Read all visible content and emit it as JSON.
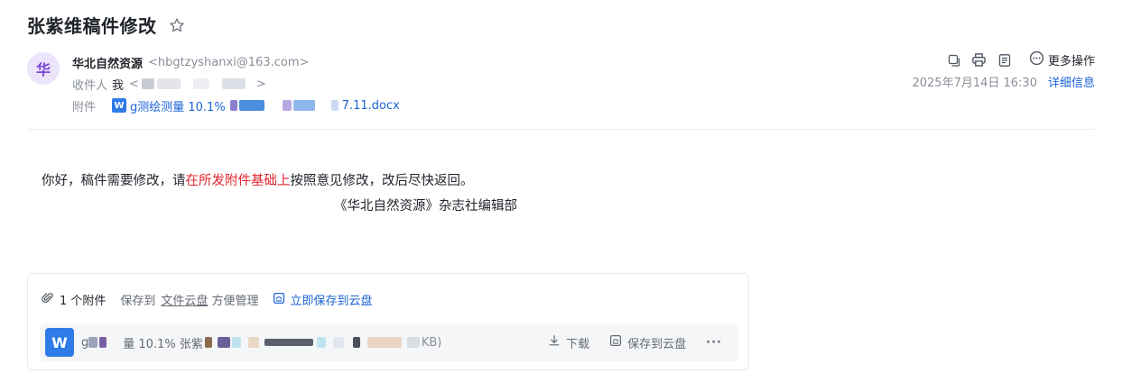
{
  "email": {
    "subject": "张紫维稿件修改",
    "avatar_char": "华",
    "sender_name": "华北自然资源",
    "sender_email": "<hbgtzyshanxi@163.com>",
    "recipient_label": "收件人",
    "recipient_me": "我",
    "recipient_open": "<",
    "recipient_close": ">",
    "attachment_label": "附件",
    "attachment_prefix": "g测绘测量 10.1%",
    "attachment_suffix": "7.11.docx",
    "date": "2025年7月14日 16:30",
    "detail_link": "详细信息",
    "more_ops": "更多操作"
  },
  "body": {
    "greeting": "你好，稿件需要修改，请",
    "highlight": "在所发附件基础上",
    "rest": "按照意见修改，改后尽快返回。",
    "signature": "《华北自然资源》杂志社编辑部"
  },
  "attachments": {
    "count_text": "1 个附件",
    "save_to": "保存到",
    "cloud_link": "文件云盘",
    "manage": "方便管理",
    "save_now": "立即保存到云盘",
    "file_icon_letter": "W",
    "file_prefix": "g",
    "file_mid": "量 10.1% 张紫",
    "file_size_tail": "KB)",
    "download": "下载",
    "save_to_cloud": "保存到云盘",
    "more": "···"
  },
  "icons": {
    "star": "star-icon",
    "copy": "copy-icon",
    "print": "print-icon",
    "note": "note-icon",
    "more": "more-icon",
    "paperclip": "paperclip-icon",
    "cloud-save": "cloud-save-icon",
    "download": "download-icon"
  },
  "colors": {
    "accent": "#1a63d6",
    "highlight_red": "#e0242b",
    "avatar_bg": "#ece4fb",
    "avatar_fg": "#7a45d6",
    "word_blue": "#2f7be8"
  }
}
